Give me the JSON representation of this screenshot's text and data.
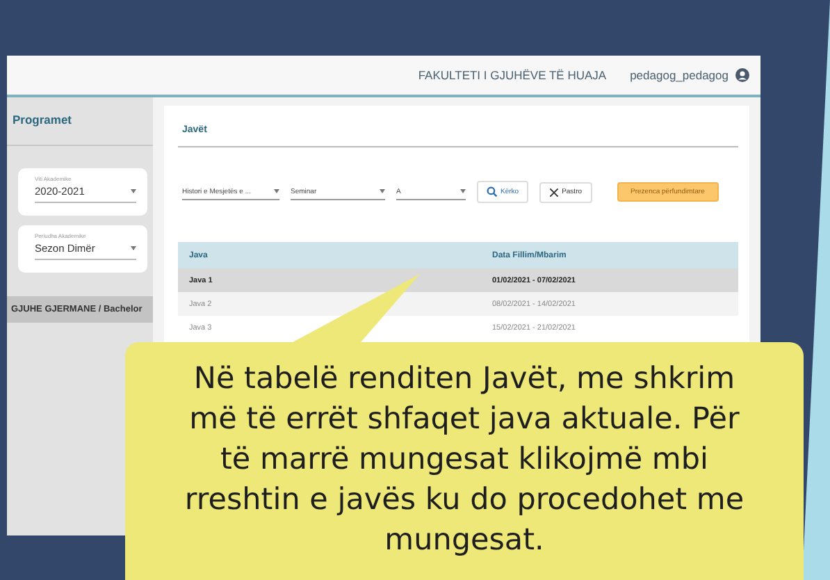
{
  "header": {
    "faculty": "FAKULTETI I GJUHËVE TË HUAJA",
    "user": "pedagog_pedagog"
  },
  "sidebar": {
    "title": "Programet",
    "selects": [
      {
        "label": "Viti Akademike",
        "value": "2020-2021"
      },
      {
        "label": "Periudha Akademike",
        "value": "Sezon Dimër"
      }
    ],
    "programs": [
      {
        "label": "GJUHE GJERMANE / Bachelor",
        "selected": true
      }
    ]
  },
  "main": {
    "title": "Javët",
    "filters": [
      {
        "value": "Histori e Mesjetës e ..."
      },
      {
        "value": "Seminar"
      },
      {
        "value": "A"
      }
    ],
    "buttons": [
      {
        "kind": "search",
        "label": "Kërko"
      },
      {
        "kind": "clear",
        "label": "Pastro"
      },
      {
        "kind": "primary",
        "label": "Prezenca përfundimtare"
      }
    ],
    "table": {
      "columns": [
        "Java",
        "Data Fillim/Mbarim"
      ],
      "rows": [
        {
          "cells": [
            "Java 1",
            "01/02/2021 - 07/02/2021"
          ],
          "current": true
        },
        {
          "cells": [
            "Java 2",
            "08/02/2021 - 14/02/2021"
          ],
          "current": false
        },
        {
          "cells": [
            "Java 3",
            "15/02/2021 - 21/02/2021"
          ],
          "current": false
        }
      ]
    }
  },
  "callout": {
    "text": "Në tabelë renditen Javët, me shkrim më të errët shfaqet java aktuale. Për të marrë mungesat klikojmë mbi rreshtin e javës ku do procedohet me mungesat."
  }
}
